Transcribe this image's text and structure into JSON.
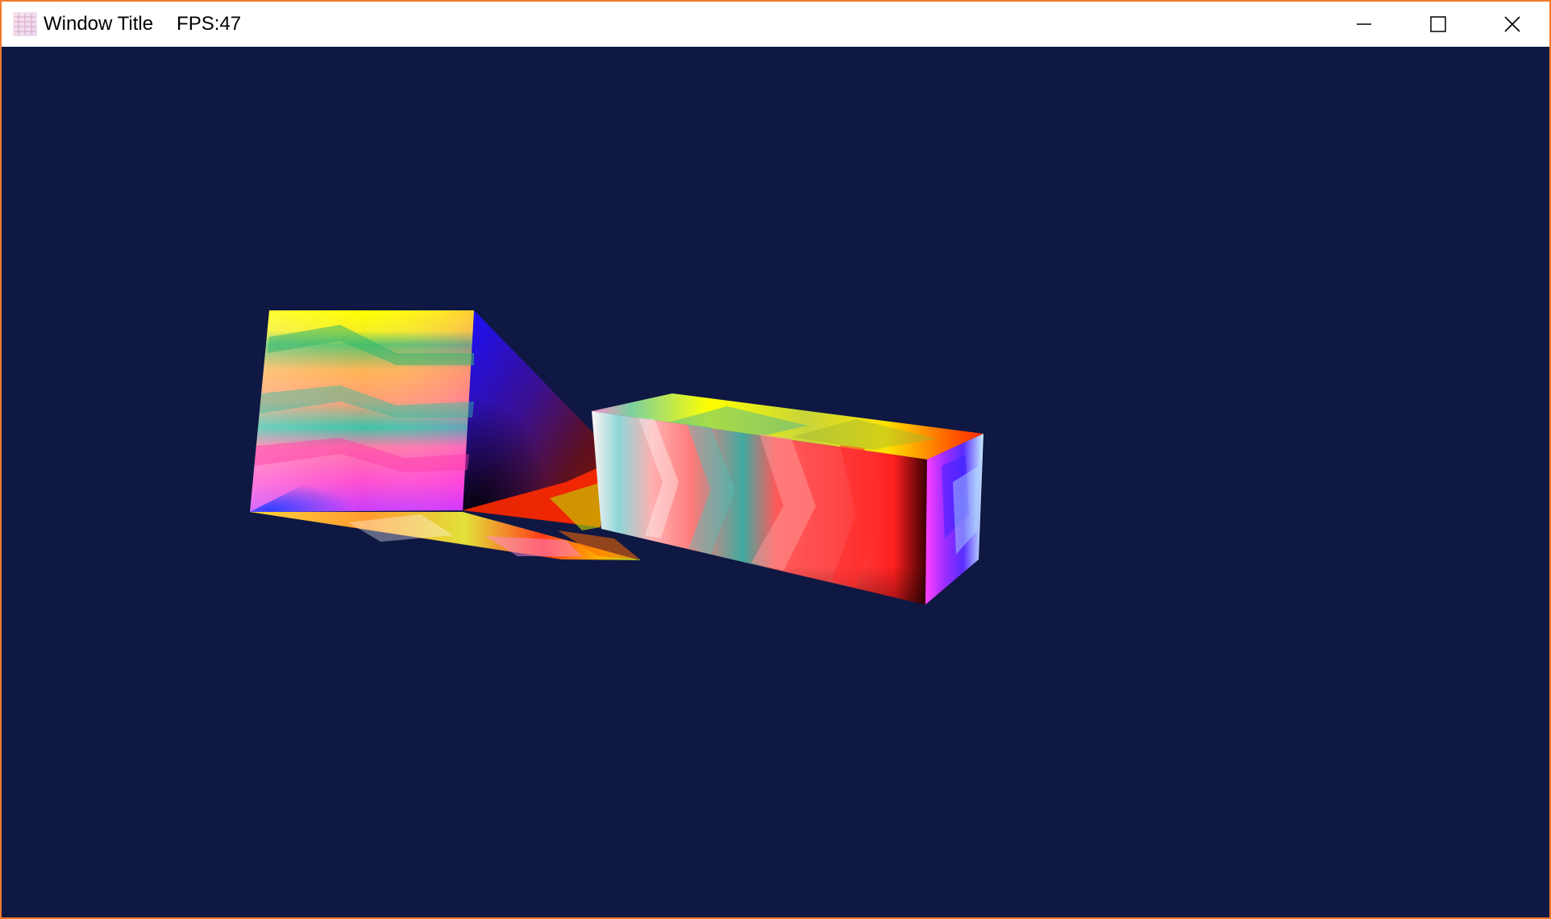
{
  "window": {
    "title": "Window Title",
    "fps_label": "FPS:47",
    "background_color": "#0e1842",
    "border_color": "#f07a2a"
  },
  "controls": {
    "minimize_icon": "minimize-icon",
    "maximize_icon": "maximize-icon",
    "close_icon": "close-icon"
  },
  "scene": {
    "objects": [
      "cube",
      "elongated-box"
    ],
    "texture": "rainbow gradient"
  }
}
